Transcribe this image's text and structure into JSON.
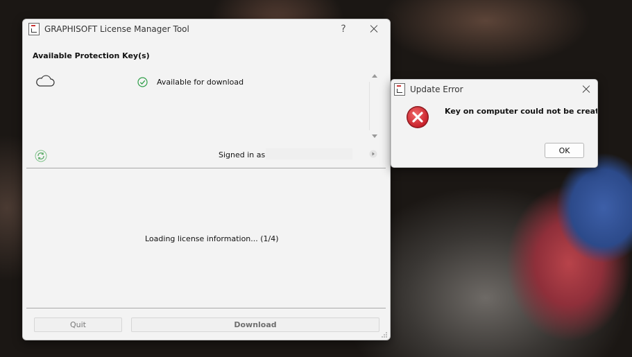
{
  "main_window": {
    "title": "GRAPHISOFT License Manager Tool",
    "help_label": "?",
    "section_heading": "Available Protection Key(s)",
    "key_status": "Available for download",
    "signed_in_label": "Signed in as",
    "loading_text": "Loading license information... (1/4)",
    "quit_label": "Quit",
    "download_label": "Download"
  },
  "error_dialog": {
    "title": "Update Error",
    "message": "Key on computer could not be created.",
    "ok_label": "OK"
  },
  "icons": {
    "cloud": "cloud-icon",
    "check": "check-circle-icon",
    "refresh": "refresh-icon",
    "error": "error-icon",
    "status_color": "#2e9e48",
    "error_color": "#c8202a"
  }
}
